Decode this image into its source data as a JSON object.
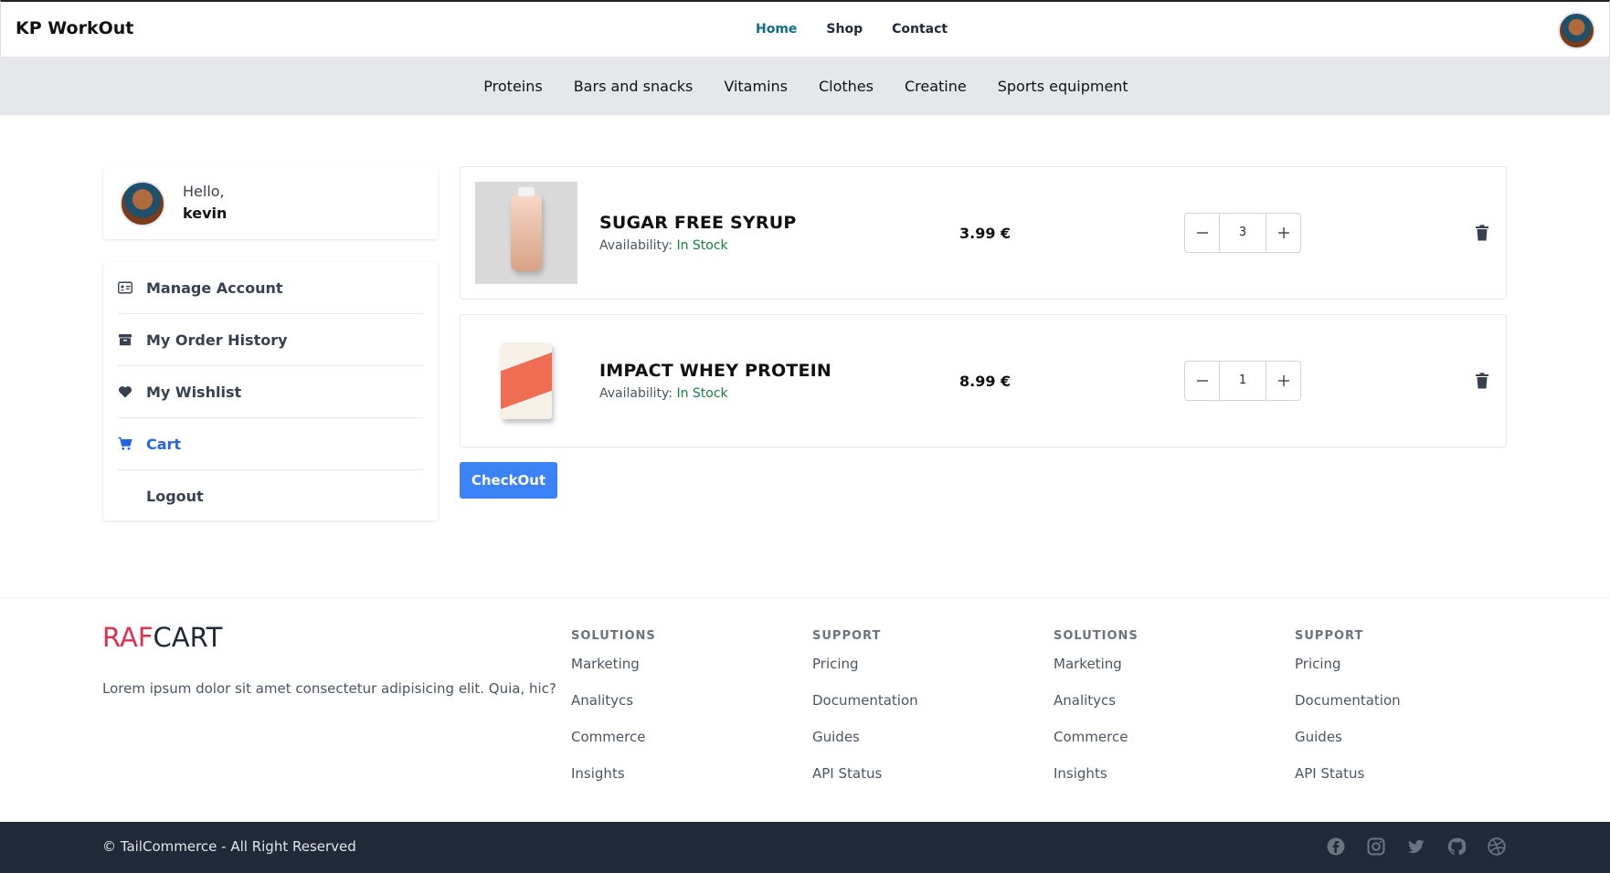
{
  "header": {
    "brand": "KP WorkOut",
    "nav": [
      "Home",
      "Shop",
      "Contact"
    ],
    "active_nav": "Home"
  },
  "categories": [
    "Proteins",
    "Bars and snacks",
    "Vitamins",
    "Clothes",
    "Creatine",
    "Sports equipment"
  ],
  "profile": {
    "greeting": "Hello,",
    "name": "kevin"
  },
  "sidebar": {
    "items": [
      {
        "label": "Manage Account",
        "icon": "id-card-icon"
      },
      {
        "label": "My Order History",
        "icon": "archive-box-icon"
      },
      {
        "label": "My Wishlist",
        "icon": "heart-icon"
      },
      {
        "label": "Cart",
        "icon": "cart-icon",
        "active": true
      },
      {
        "label": "Logout",
        "icon": ""
      }
    ]
  },
  "cart": {
    "items": [
      {
        "name": "SUGAR FREE SYRUP",
        "availability_label": "Availability:",
        "availability": "In Stock",
        "price": "3.99 €",
        "quantity": "3"
      },
      {
        "name": "IMPACT WHEY PROTEIN",
        "availability_label": "Availability:",
        "availability": "In Stock",
        "price": "8.99 €",
        "quantity": "1"
      }
    ],
    "checkout_label": "CheckOut"
  },
  "footer": {
    "logo_part1": "RAF",
    "logo_part2": "CART",
    "description": "Lorem ipsum dolor sit amet consectetur adipisicing elit. Quia, hic?",
    "columns": [
      {
        "title": "SOLUTIONS",
        "links": [
          "Marketing",
          "Analitycs",
          "Commerce",
          "Insights"
        ]
      },
      {
        "title": "SUPPORT",
        "links": [
          "Pricing",
          "Documentation",
          "Guides",
          "API Status"
        ]
      },
      {
        "title": "SOLUTIONS",
        "links": [
          "Marketing",
          "Analitycs",
          "Commerce",
          "Insights"
        ]
      },
      {
        "title": "SUPPORT",
        "links": [
          "Pricing",
          "Documentation",
          "Guides",
          "API Status"
        ]
      }
    ],
    "copyright": "© TailCommerce - All Right Reserved",
    "socials": [
      "facebook-icon",
      "instagram-icon",
      "twitter-icon",
      "github-icon",
      "dribbble-icon"
    ]
  },
  "colors": {
    "accent": "#3b82f6",
    "active_link": "#2563eb",
    "stock": "#15803d",
    "logo_red": "#e0304e",
    "footer_bar": "#1f2937"
  }
}
